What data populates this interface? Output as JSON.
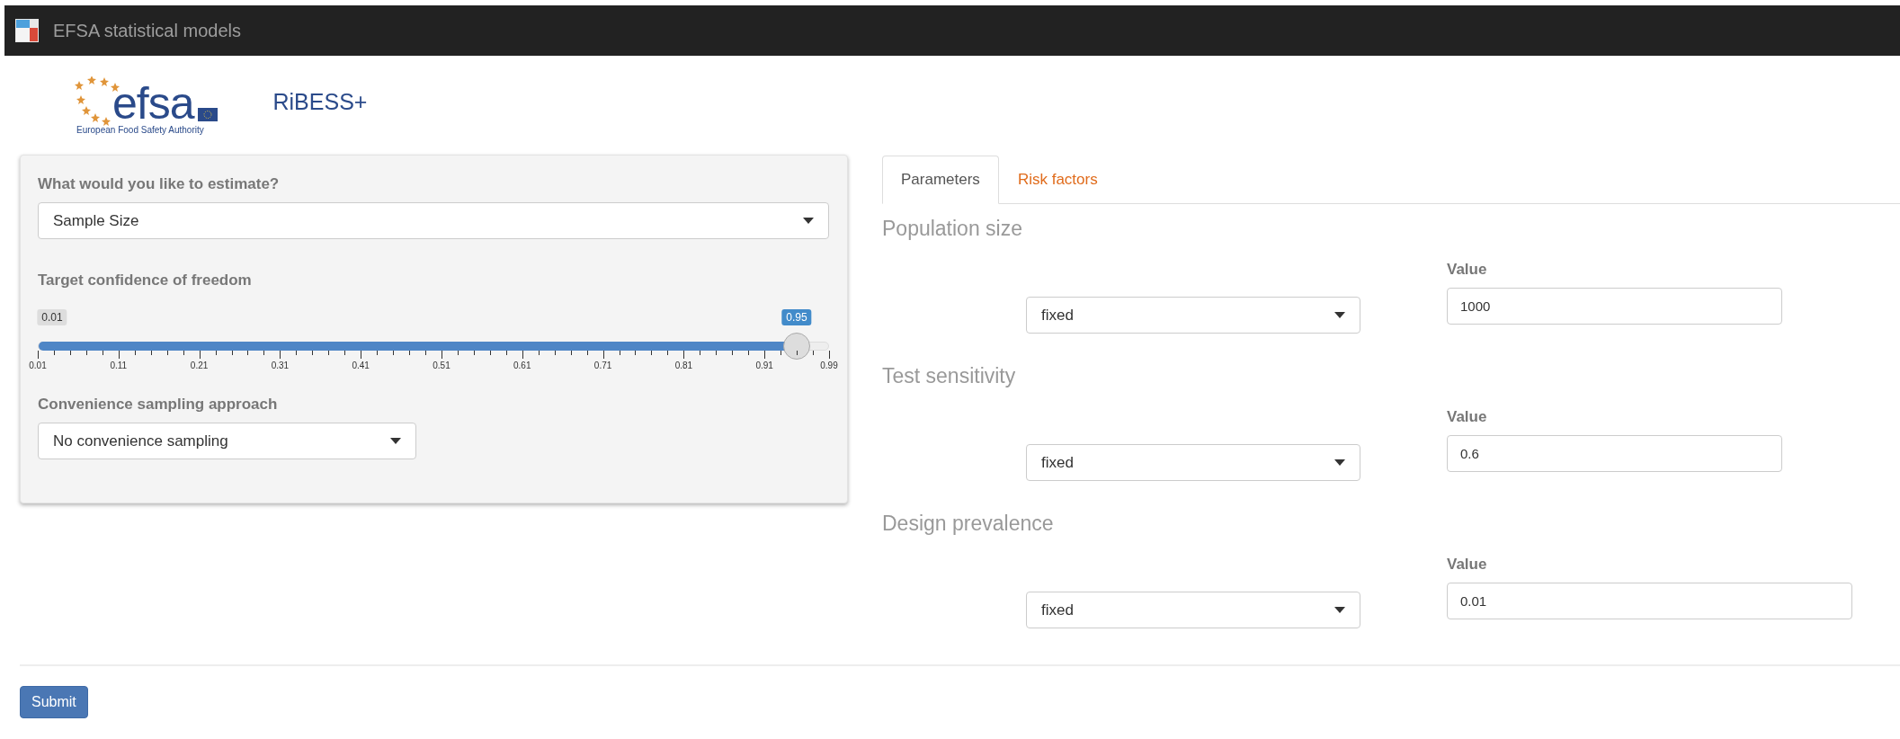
{
  "navbar": {
    "title": "EFSA statistical models"
  },
  "header": {
    "logo_word": "efsa",
    "logo_caption": "European Food Safety Authority",
    "app_name": "RiBESS+"
  },
  "sidebar": {
    "estimate": {
      "label": "What would you like to estimate?",
      "value": "Sample Size"
    },
    "confidence": {
      "label": "Target confidence of freedom",
      "min_label": "0.01",
      "value_label": "0.95",
      "level": 0.959,
      "ticks": [
        "0.01",
        "0.11",
        "0.21",
        "0.31",
        "0.41",
        "0.51",
        "0.61",
        "0.71",
        "0.81",
        "0.91",
        "0.99"
      ]
    },
    "convenience": {
      "label": "Convenience sampling approach",
      "value": "No convenience sampling"
    }
  },
  "tabs": [
    {
      "label": "Parameters",
      "selected": true
    },
    {
      "label": "Risk factors",
      "selected": false
    }
  ],
  "parameters": [
    {
      "title": "Population size",
      "distribution": "fixed",
      "value_label": "Value",
      "value": "1000"
    },
    {
      "title": "Test sensitivity",
      "distribution": "fixed",
      "value_label": "Value",
      "value": "0.6"
    },
    {
      "title": "Design prevalence",
      "distribution": "fixed",
      "value_label": "Value",
      "value": "0.01"
    }
  ],
  "submit": {
    "label": "Submit"
  }
}
